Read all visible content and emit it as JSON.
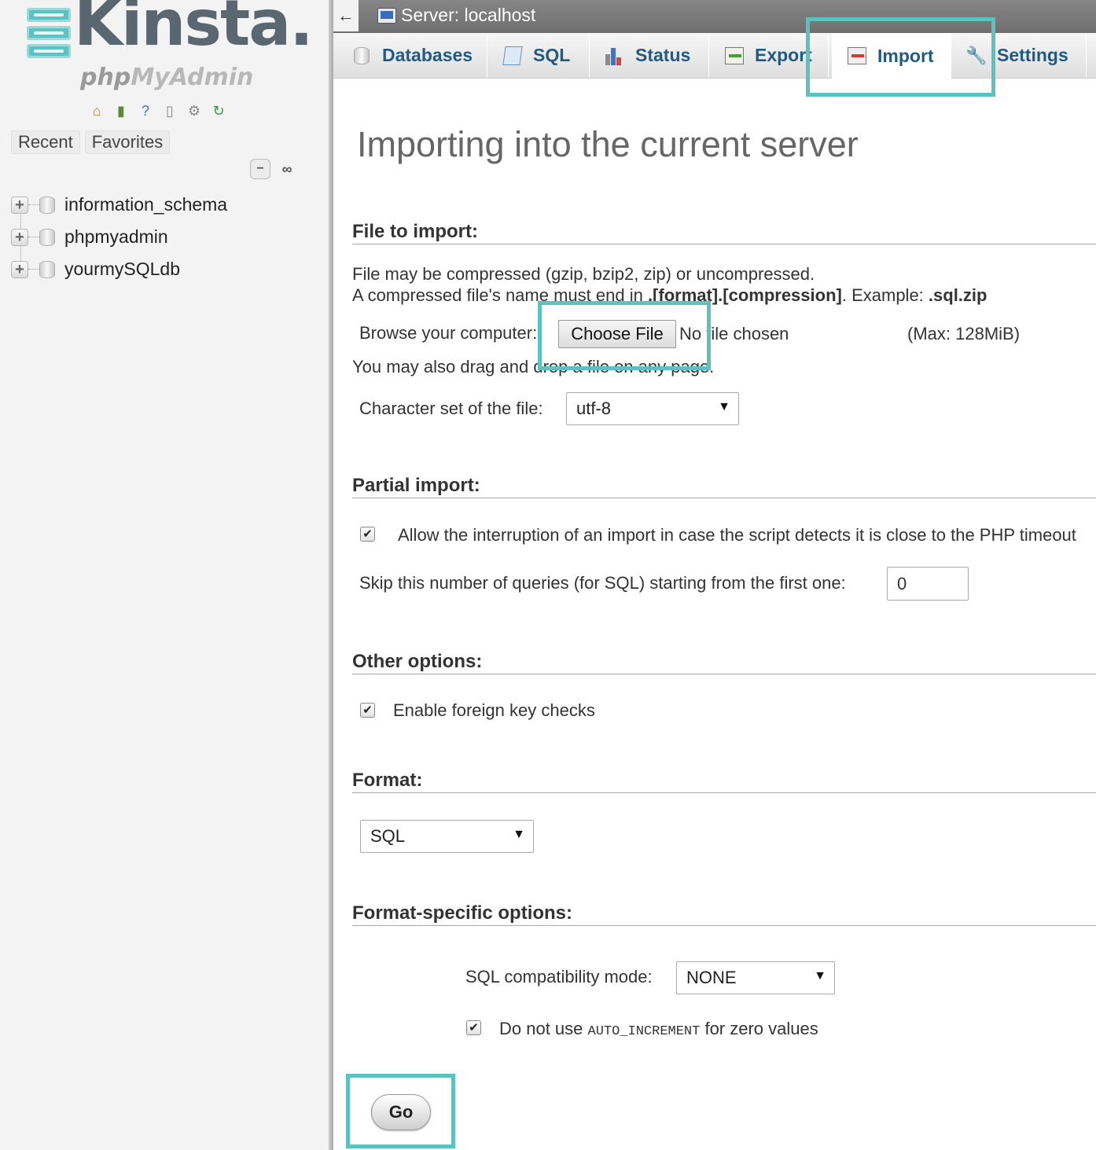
{
  "sidebar": {
    "logo": {
      "brand": "Kinsta",
      "brand_dot": ".",
      "sub_prefix": "php",
      "sub_my": "My",
      "sub_suffix": "Admin"
    },
    "toolbar_icons": [
      "home-icon",
      "logout-icon",
      "help-icon",
      "docs-icon",
      "settings-icon",
      "reload-icon"
    ],
    "tabs": [
      "Recent",
      "Favorites"
    ],
    "databases": [
      "information_schema",
      "phpmyadmin",
      "yourmySQLdb"
    ]
  },
  "topbar": {
    "back": "←",
    "server_label": "Server: localhost"
  },
  "tabs": [
    {
      "label": "Databases",
      "icon": "database-icon"
    },
    {
      "label": "SQL",
      "icon": "sql-icon"
    },
    {
      "label": "Status",
      "icon": "status-icon"
    },
    {
      "label": "Export",
      "icon": "export-icon"
    },
    {
      "label": "Import",
      "icon": "import-icon",
      "active": true
    },
    {
      "label": "Settings",
      "icon": "wrench-icon"
    }
  ],
  "page": {
    "title": "Importing into the current server",
    "file_section": {
      "heading": "File to import:",
      "line1": "File may be compressed (gzip, bzip2, zip) or uncompressed.",
      "line2_a": "A compressed file's name must end in ",
      "line2_b": ".[format].[compression]",
      "line2_c": ". Example: ",
      "line2_d": ".sql.zip",
      "browse_label": "Browse your computer:",
      "choose_file": "Choose File",
      "no_file": "No file chosen",
      "max": "(Max: 128MiB)",
      "drag_hint": "You may also drag and drop a file on any page.",
      "charset_label": "Character set of the file:",
      "charset_value": "utf-8"
    },
    "partial_section": {
      "heading": "Partial import:",
      "allow_interrupt": "Allow the interruption of an import in case the script detects it is close to the PHP timeout",
      "allow_interrupt_checked": true,
      "skip_label": "Skip this number of queries (for SQL) starting from the first one:",
      "skip_value": "0"
    },
    "other_section": {
      "heading": "Other options:",
      "foreign_keys": "Enable foreign key checks",
      "foreign_keys_checked": true
    },
    "format_section": {
      "heading": "Format:",
      "value": "SQL"
    },
    "format_specific": {
      "heading": "Format-specific options:",
      "compat_label": "SQL compatibility mode:",
      "compat_value": "NONE",
      "auto_inc_prefix": "Do not use ",
      "auto_inc_code": "AUTO_INCREMENT",
      "auto_inc_suffix": " for zero values",
      "auto_inc_checked": true
    },
    "go_button": "Go"
  },
  "colors": {
    "highlight": "#5cc2c0",
    "tab_text": "#235a81",
    "topbar": "#7a7a7a"
  }
}
